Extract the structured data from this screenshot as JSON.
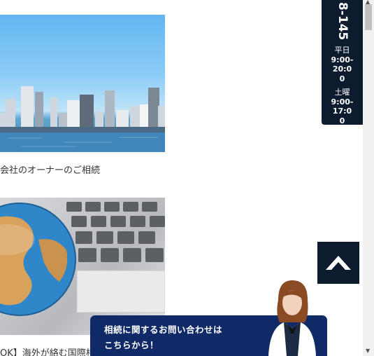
{
  "articles": [
    {
      "title": "会社のオーナーのご相続",
      "image": "city-skyline"
    },
    {
      "title": "OK】海外が絡む国際相",
      "image": "globe-keyboard"
    }
  ],
  "phone_banner": {
    "number": "8-145",
    "weekday_label": "平日",
    "weekday_hours": "9:00-20:00",
    "saturday_label": "土曜",
    "saturday_hours": "9:00-17:00"
  },
  "scroll_top": {
    "icon": "chevron-up-icon"
  },
  "contact_cta": {
    "line1": "相続に関するお問い合わせは",
    "line2": "こちらから！"
  },
  "colors": {
    "navy": "#0d1b2e",
    "cta_blue": "#0f2a66"
  }
}
